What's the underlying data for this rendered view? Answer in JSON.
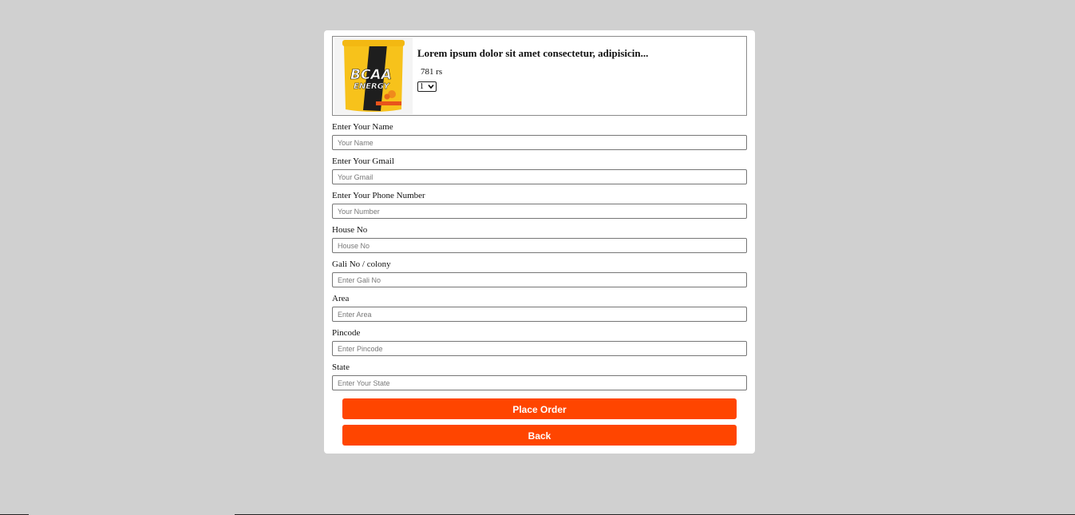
{
  "product": {
    "image_label_brand": "BCAA",
    "image_label_sub": "ENERGY",
    "title": "Lorem ipsum dolor sit amet consectetur, adipisicin...",
    "price": "781 rs",
    "quantity": "1"
  },
  "form": {
    "fields": [
      {
        "label": "Enter Your Name",
        "placeholder": "Your Name"
      },
      {
        "label": "Enter Your Gmail",
        "placeholder": "Your Gmail"
      },
      {
        "label": "Enter Your Phone Number",
        "placeholder": "Your Number"
      },
      {
        "label": "House No",
        "placeholder": "House No"
      },
      {
        "label": "Gali No / colony",
        "placeholder": "Enter Gali No"
      },
      {
        "label": "Area",
        "placeholder": "Enter Area"
      },
      {
        "label": "Pincode",
        "placeholder": "Enter Pincode"
      },
      {
        "label": "State",
        "placeholder": "Enter Your State"
      }
    ],
    "place_order_label": "Place Order",
    "back_label": "Back"
  },
  "colors": {
    "background": "#d0d0d0",
    "accent": "#ff4500",
    "card": "#ffffff"
  }
}
